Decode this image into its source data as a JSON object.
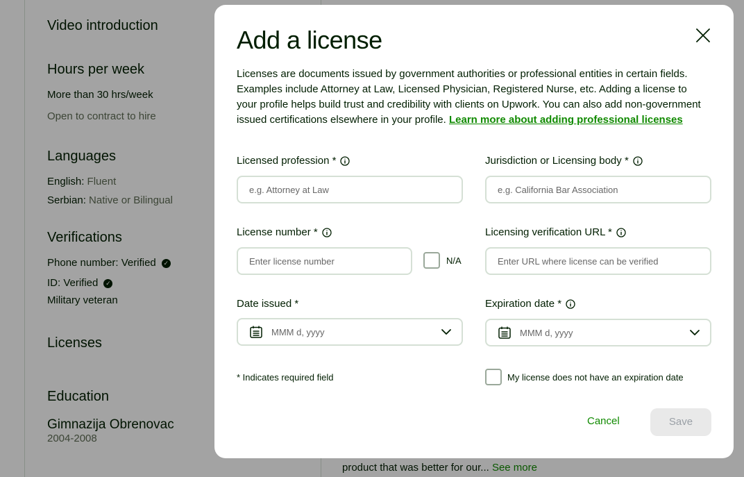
{
  "background": {
    "sidebar": {
      "video_intro": "Video introduction",
      "hours_heading": "Hours per week",
      "hours_value": "More than 30 hrs/week",
      "contract_note": "Open to contract to hire",
      "languages_heading": "Languages",
      "languages": [
        {
          "name": "English:",
          "level": "Fluent"
        },
        {
          "name": "Serbian:",
          "level": "Native or Bilingual"
        }
      ],
      "verifications_heading": "Verifications",
      "phone_verified": "Phone number: Verified",
      "id_verified": "ID: Verified",
      "military": "Military veteran",
      "licenses_heading": "Licenses",
      "education_heading": "Education",
      "school": "Gimnazija Obrenovac",
      "school_years": "2004-2008"
    },
    "main": {
      "snippet": "product that was better for our...",
      "see_more": "See more"
    }
  },
  "modal": {
    "title": "Add a license",
    "description": "Licenses are documents issued by government authorities or professional entities in certain fields. Examples include Attorney at Law, Licensed Physician, Registered Nurse, etc. Adding a license to your profile helps build trust and credibility with clients on Upwork. You can also add non-government issued certifications elsewhere in your profile. ",
    "learn_more": "Learn more about adding professional licenses",
    "fields": {
      "profession_label": "Licensed profession *",
      "profession_placeholder": "e.g. Attorney at Law",
      "jurisdiction_label": "Jurisdiction or Licensing body *",
      "jurisdiction_placeholder": "e.g. California Bar Association",
      "number_label": "License number *",
      "number_placeholder": "Enter license number",
      "na_label": "N/A",
      "url_label": "Licensing verification URL *",
      "url_placeholder": "Enter URL where license can be verified",
      "issued_label": "Date issued *",
      "issued_placeholder": "MMM d, yyyy",
      "expiration_label": "Expiration date *",
      "expiration_placeholder": "MMM d, yyyy",
      "no_expiration_label": "My license does not have an expiration date"
    },
    "required_note": "* Indicates required field",
    "cancel_label": "Cancel",
    "save_label": "Save"
  },
  "colors": {
    "accent": "#108a00",
    "text": "#001e00",
    "border": "#d5e0d5"
  }
}
